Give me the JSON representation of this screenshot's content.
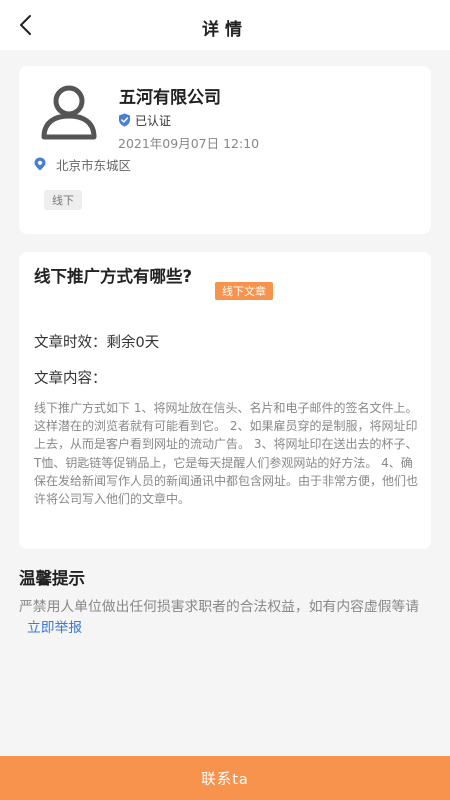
{
  "nav": {
    "title": "详情",
    "back_icon": "chevron-left-icon"
  },
  "company": {
    "name": "五河有限公司",
    "verified_label": "已认证",
    "datetime": "2021年09月07日 12:10",
    "location": "北京市东城区",
    "tag": "线下",
    "avatar_icon": "user-avatar-icon",
    "verified_icon": "shield-check-icon",
    "location_icon": "map-pin-icon",
    "verified_color": "#4a7fd8",
    "pin_color": "#4a7fd8"
  },
  "article": {
    "title": "线下推广方式有哪些?",
    "tag": "线下文章",
    "validity": "文章时效：剩余0天",
    "content_label": "文章内容：",
    "content": "线下推广方式如下 1、将网址放在信头、名片和电子邮件的签名文件上。这样潜在的浏览者就有可能看到它。 2、如果雇员穿的是制服，将网址印上去，从而是客户看到网址的流动广告。 3、将网址印在送出去的杯子、T恤、钥匙链等促销品上，它是每天提醒人们参观网站的好方法。 4、确保在发给新闻写作人员的新闻通讯中都包含网址。由于非常方便，他们也许将公司写入他们的文章中。"
  },
  "tips": {
    "title": "温馨提示",
    "body": "严禁用人单位做出任何损害求职者的合法权益，如有内容虚假等请",
    "report_link": "立即举报"
  },
  "footer": {
    "contact_label": "联系ta"
  },
  "colors": {
    "accent": "#f7934c",
    "link": "#3b7bd1",
    "background": "#f5f5f5"
  }
}
